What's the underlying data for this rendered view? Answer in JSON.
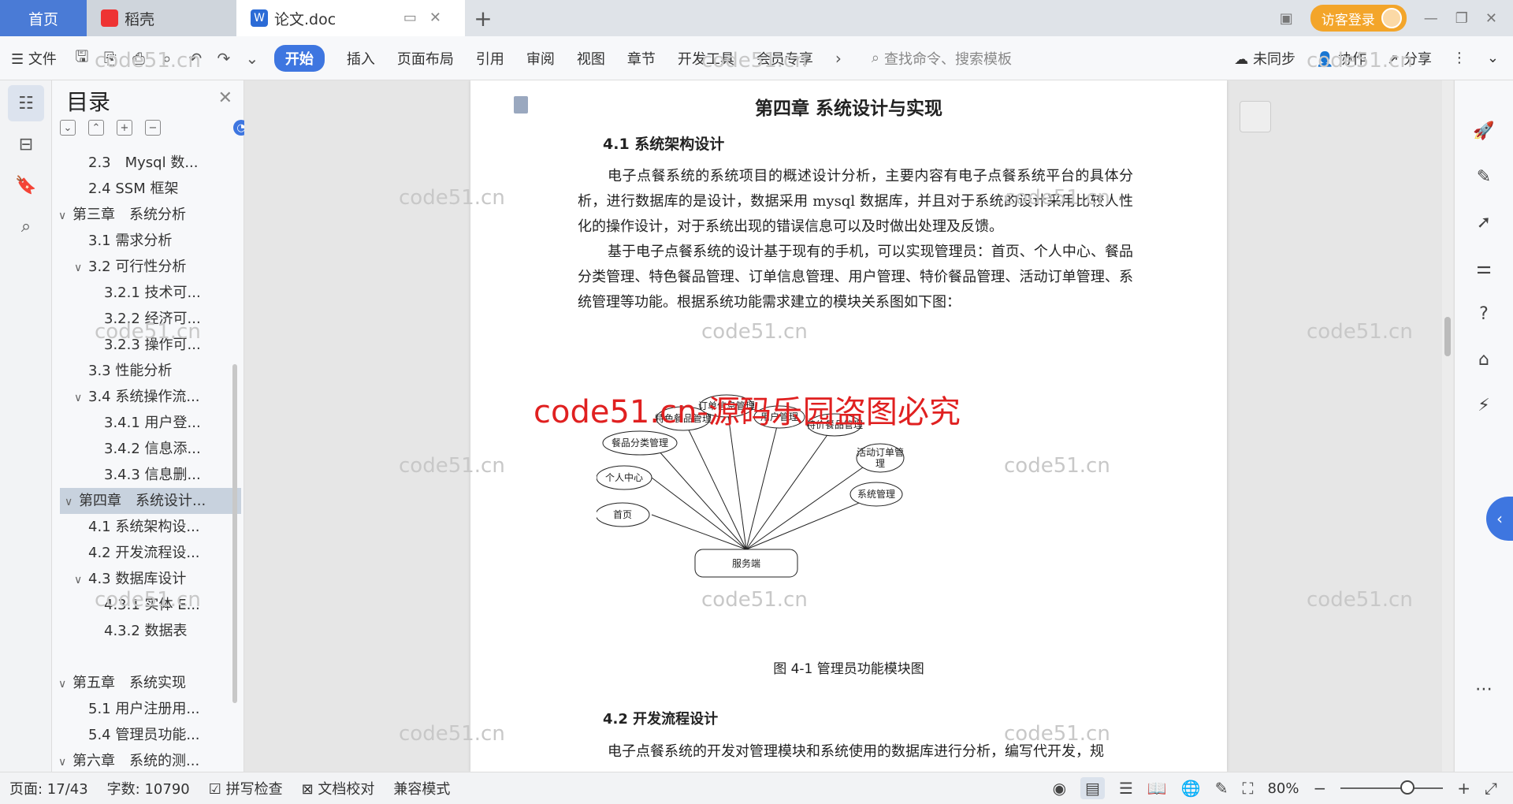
{
  "tabs": {
    "home": "首页",
    "daoke": "稻壳",
    "doc": "论文.doc",
    "new_tab": "+"
  },
  "window": {
    "login": "访客登录"
  },
  "toolbar": {
    "file": "文件",
    "menus": [
      "开始",
      "插入",
      "页面布局",
      "引用",
      "审阅",
      "视图",
      "章节",
      "开发工具",
      "会员专享"
    ],
    "search_placeholder": "查找命令、搜索模板",
    "sync": "未同步",
    "collab": "协作",
    "share": "分享"
  },
  "toc": {
    "title": "目录",
    "items": [
      {
        "label": "2.3　Mysql 数...",
        "level": 2,
        "arrow": ""
      },
      {
        "label": "2.4 SSM 框架",
        "level": 2,
        "arrow": ""
      },
      {
        "label": "第三章　系统分析",
        "level": 1,
        "arrow": "∨"
      },
      {
        "label": "3.1 需求分析",
        "level": 2,
        "arrow": ""
      },
      {
        "label": "3.2 可行性分析",
        "level": 2,
        "arrow": "∨"
      },
      {
        "label": "3.2.1 技术可...",
        "level": 3,
        "arrow": ""
      },
      {
        "label": "3.2.2 经济可...",
        "level": 3,
        "arrow": ""
      },
      {
        "label": "3.2.3 操作可...",
        "level": 3,
        "arrow": ""
      },
      {
        "label": "3.3 性能分析",
        "level": 2,
        "arrow": ""
      },
      {
        "label": "3.4 系统操作流...",
        "level": 2,
        "arrow": "∨"
      },
      {
        "label": "3.4.1 用户登...",
        "level": 3,
        "arrow": ""
      },
      {
        "label": "3.4.2 信息添...",
        "level": 3,
        "arrow": ""
      },
      {
        "label": "3.4.3 信息删...",
        "level": 3,
        "arrow": ""
      },
      {
        "label": "第四章　系统设计...",
        "level": 1,
        "arrow": "∨",
        "selected": true
      },
      {
        "label": "4.1 系统架构设...",
        "level": 2,
        "arrow": ""
      },
      {
        "label": "4.2 开发流程设...",
        "level": 2,
        "arrow": ""
      },
      {
        "label": "4.3 数据库设计",
        "level": 2,
        "arrow": "∨"
      },
      {
        "label": "4.3.1 实体 E...",
        "level": 3,
        "arrow": ""
      },
      {
        "label": "4.3.2 数据表",
        "level": 3,
        "arrow": ""
      },
      {
        "label": "",
        "level": 0,
        "arrow": ""
      },
      {
        "label": "第五章　系统实现",
        "level": 1,
        "arrow": "∨"
      },
      {
        "label": "5.1 用户注册用...",
        "level": 2,
        "arrow": ""
      },
      {
        "label": "5.4 管理员功能...",
        "level": 2,
        "arrow": ""
      },
      {
        "label": "第六章　系统的测...",
        "level": 1,
        "arrow": "∨"
      }
    ]
  },
  "document": {
    "chapter": "第四章  系统设计与实现",
    "h41": "4.1 系统架构设计",
    "p1": "电子点餐系统的系统项目的概述设计分析，主要内容有电子点餐系统平台的具体分析，进行数据库的是设计，数据采用 mysql 数据库，并且对于系统的设计采用比较人性化的操作设计，对于系统出现的错误信息可以及时做出处理及反馈。",
    "p2": "基于电子点餐系统的设计基于现有的手机，可以实现管理员：首页、个人中心、餐品分类管理、特色餐品管理、订单信息管理、用户管理、特价餐品管理、活动订单管理、系统管理等功能。根据系统功能需求建立的模块关系图如下图：",
    "caption": "图 4-1 管理员功能模块图",
    "h42": "4.2 开发流程设计",
    "p3": "电子点餐系统的开发对管理模块和系统使用的数据库进行分析，编写代开发，规"
  },
  "diagram": {
    "server": "服务端",
    "nodes": [
      "首页",
      "个人中心",
      "餐品分类管理",
      "特色餐品管理",
      "订单信息管理",
      "用户管理",
      "特价餐品管理",
      "活动订单管",
      "理",
      "系统管理"
    ]
  },
  "watermark": {
    "red": "code51.cn-源码乐园盗图必究",
    "gray": "code51.cn"
  },
  "status": {
    "page": "页面: 17/43",
    "words": "字数: 10790",
    "spell": "拼写检查",
    "proof": "文档校对",
    "compat": "兼容模式",
    "zoom": "80%"
  }
}
